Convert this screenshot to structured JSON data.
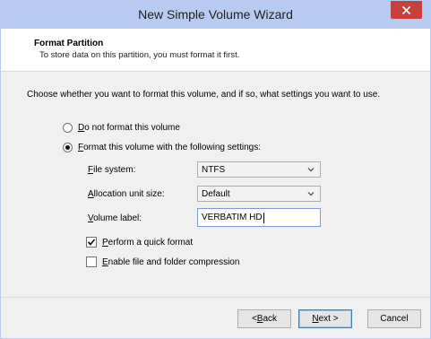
{
  "window": {
    "title": "New Simple Volume Wizard"
  },
  "header": {
    "title": "Format Partition",
    "subtitle": "To store data on this partition, you must format it first."
  },
  "body": {
    "prompt": "Choose whether you want to format this volume, and if so, what settings you want to use.",
    "options": {
      "no_format": {
        "mnemonic": "D",
        "rest": "o not format this volume",
        "checked": false
      },
      "format": {
        "mnemonic": "F",
        "rest": "ormat this volume with the following settings:",
        "checked": true
      }
    },
    "fields": {
      "file_system": {
        "mnemonic": "F",
        "rest": "ile system:",
        "value": "NTFS"
      },
      "allocation": {
        "mnemonic": "A",
        "rest": "llocation unit size:",
        "value": "Default"
      },
      "volume_label": {
        "mnemonic": "V",
        "rest": "olume label:",
        "value": "VERBATIM HD"
      }
    },
    "checks": {
      "quick_format": {
        "mnemonic": "P",
        "rest": "erform a quick format",
        "checked": true
      },
      "compression": {
        "mnemonic": "E",
        "rest": "nable file and folder compression",
        "checked": false
      }
    }
  },
  "footer": {
    "back": {
      "prefix": "< ",
      "mnemonic": "B",
      "rest": "ack"
    },
    "next": {
      "mnemonic": "N",
      "rest": "ext >"
    },
    "cancel": "Cancel"
  },
  "colors": {
    "titlebar": "#b7cbf0",
    "close": "#c7413c",
    "background": "#f0f0f0"
  },
  "icons": {
    "close": "close-icon",
    "dropdown": "chevron-down-icon",
    "check": "checkmark-icon"
  }
}
